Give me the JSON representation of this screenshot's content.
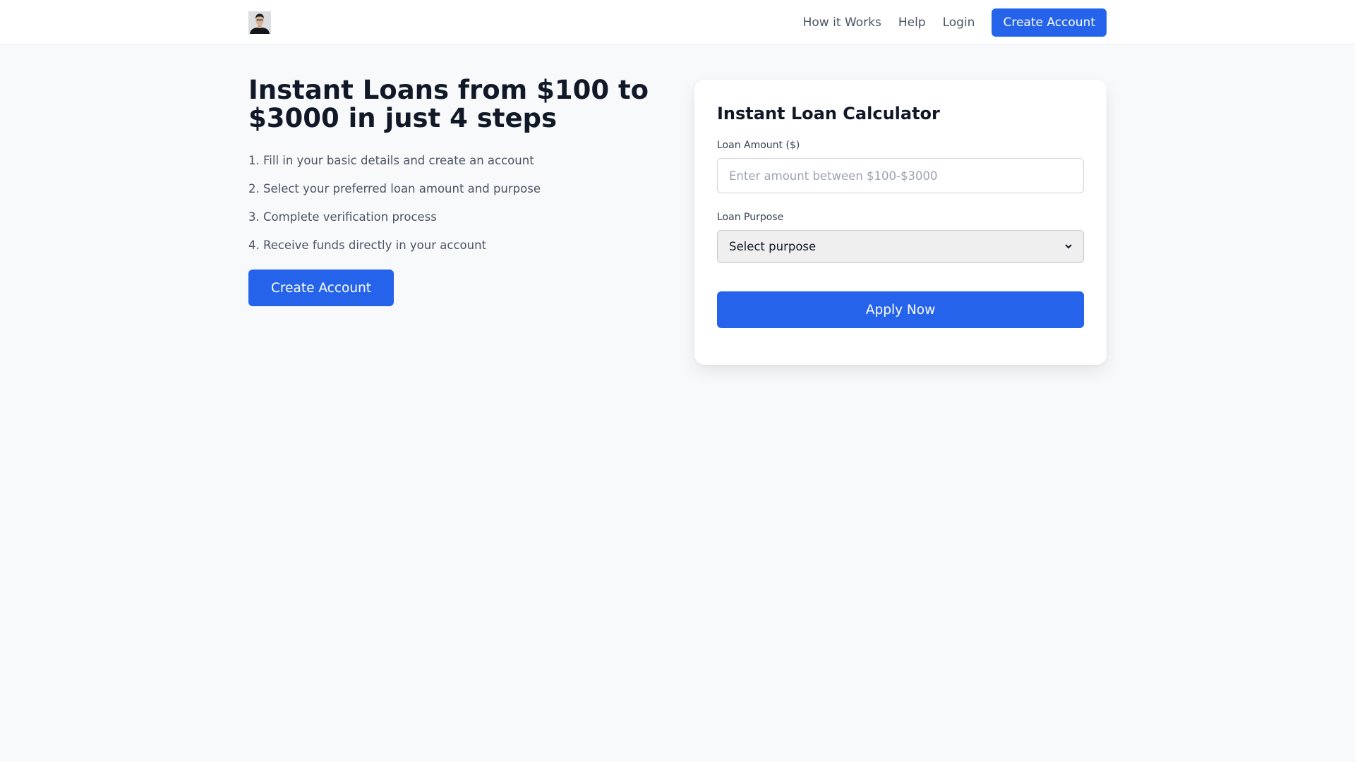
{
  "header": {
    "nav": {
      "how_it_works": "How it Works",
      "help": "Help",
      "login": "Login",
      "create_account": "Create Account"
    }
  },
  "hero": {
    "title": "Instant Loans from $100 to $3000 in just 4 steps",
    "steps": [
      "1. Fill in your basic details and create an account",
      "2. Select your preferred loan amount and purpose",
      "3. Complete verification process",
      "4. Receive funds directly in your account"
    ],
    "cta": "Create Account"
  },
  "calculator": {
    "title": "Instant Loan Calculator",
    "amount_label": "Loan Amount ($)",
    "amount_placeholder": "Enter amount between $100-$3000",
    "amount_value": "",
    "purpose_label": "Loan Purpose",
    "purpose_selected": "Select purpose",
    "apply_label": "Apply Now"
  },
  "icons": {
    "avatar": "user-avatar",
    "select": "chevron-down-icon"
  },
  "colors": {
    "accent": "#2563eb",
    "page_background": "#f8f9fb",
    "text_primary": "#111827",
    "text_secondary": "#4b5563"
  }
}
